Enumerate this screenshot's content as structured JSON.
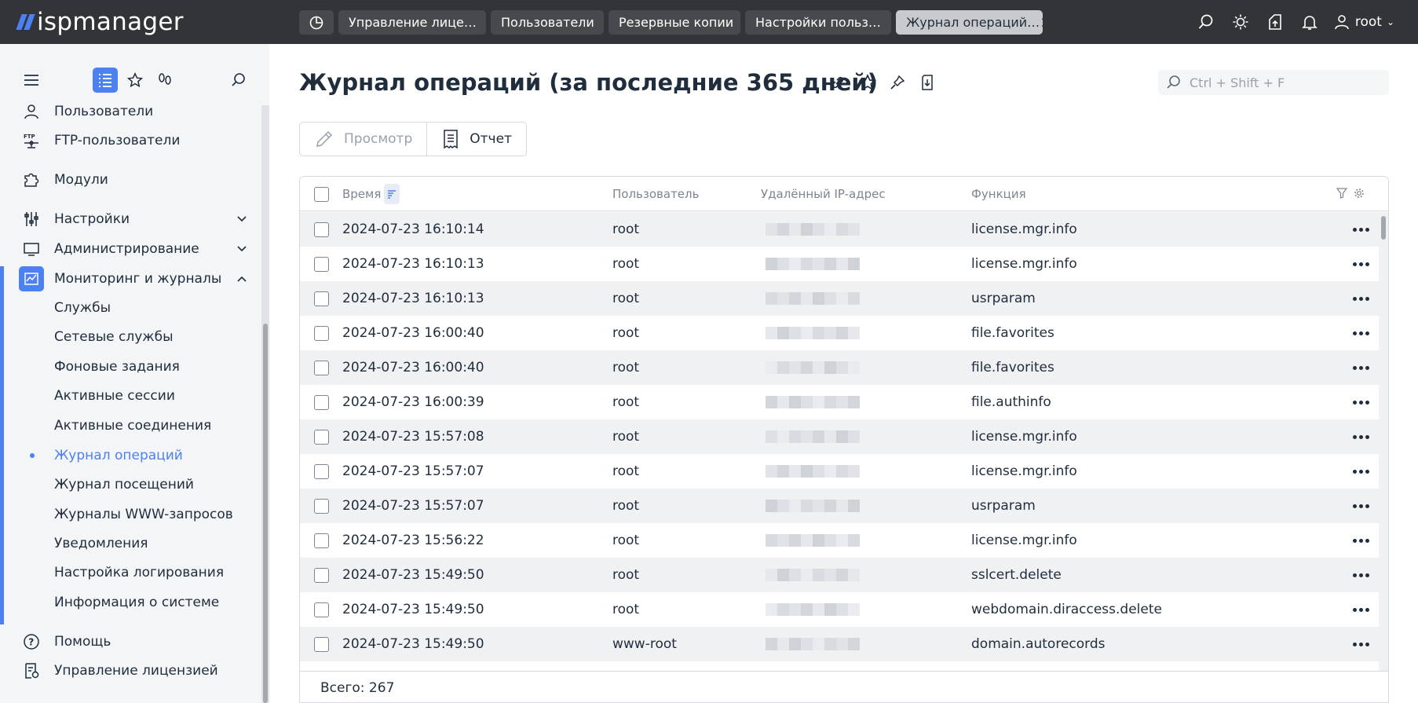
{
  "app": {
    "logo_text": "ispmanager"
  },
  "tabs": [
    {
      "label": "Управление лице…"
    },
    {
      "label": "Пользователи"
    },
    {
      "label": "Резервные копии"
    },
    {
      "label": "Настройки польз…"
    },
    {
      "label": "Журнал операций…",
      "active": true
    }
  ],
  "user": {
    "name": "root"
  },
  "sidebar": {
    "tools": [
      "menu-icon",
      "list-icon",
      "star-icon",
      "footprints-icon",
      "search-icon"
    ],
    "items": [
      {
        "label": "Пользователи",
        "icon": "user-icon"
      },
      {
        "label": "FTP-пользователи",
        "icon": "ftp-icon"
      },
      {
        "label": "Модули",
        "icon": "puzzle-icon"
      },
      {
        "label": "Настройки",
        "icon": "sliders-icon",
        "expandable": true
      },
      {
        "label": "Администрирование",
        "icon": "monitor-icon",
        "expandable": true
      },
      {
        "label": "Мониторинг и журналы",
        "icon": "chart-icon",
        "expanded": true
      },
      {
        "label": "Помощь",
        "icon": "help-icon"
      },
      {
        "label": "Управление лицензией",
        "icon": "license-icon"
      }
    ],
    "subitems": [
      {
        "label": "Службы"
      },
      {
        "label": "Сетевые службы"
      },
      {
        "label": "Фоновые задания"
      },
      {
        "label": "Активные сессии"
      },
      {
        "label": "Активные соединения"
      },
      {
        "label": "Журнал операций",
        "current": true
      },
      {
        "label": "Журнал посещений"
      },
      {
        "label": "Журналы WWW-запросов"
      },
      {
        "label": "Уведомления"
      },
      {
        "label": "Настройка логирования"
      },
      {
        "label": "Информация о системе"
      }
    ]
  },
  "page": {
    "title": "Журнал операций (за последние 365 дней)",
    "search_placeholder": "Ctrl + Shift + F"
  },
  "toolbar": {
    "view_label": "Просмотр",
    "report_label": "Отчет"
  },
  "table": {
    "columns": [
      "Время",
      "Пользователь",
      "Удалённый IP-адрес",
      "Функция"
    ],
    "rows": [
      {
        "time": "2024-07-23 16:10:14",
        "user": "root",
        "func": "license.mgr.info"
      },
      {
        "time": "2024-07-23 16:10:13",
        "user": "root",
        "func": "license.mgr.info"
      },
      {
        "time": "2024-07-23 16:10:13",
        "user": "root",
        "func": "usrparam"
      },
      {
        "time": "2024-07-23 16:00:40",
        "user": "root",
        "func": "file.favorites"
      },
      {
        "time": "2024-07-23 16:00:40",
        "user": "root",
        "func": "file.favorites"
      },
      {
        "time": "2024-07-23 16:00:39",
        "user": "root",
        "func": "file.authinfo"
      },
      {
        "time": "2024-07-23 15:57:08",
        "user": "root",
        "func": "license.mgr.info"
      },
      {
        "time": "2024-07-23 15:57:07",
        "user": "root",
        "func": "license.mgr.info"
      },
      {
        "time": "2024-07-23 15:57:07",
        "user": "root",
        "func": "usrparam"
      },
      {
        "time": "2024-07-23 15:56:22",
        "user": "root",
        "func": "license.mgr.info"
      },
      {
        "time": "2024-07-23 15:49:50",
        "user": "root",
        "func": "sslcert.delete"
      },
      {
        "time": "2024-07-23 15:49:50",
        "user": "root",
        "func": "webdomain.diraccess.delete"
      },
      {
        "time": "2024-07-23 15:49:50",
        "user": "www-root",
        "func": "domain.autorecords"
      }
    ],
    "total_label": "Всего: 267"
  },
  "colors": {
    "accent": "#4d80f2",
    "topbar": "#333437",
    "sidebar": "#f4f5f7"
  }
}
